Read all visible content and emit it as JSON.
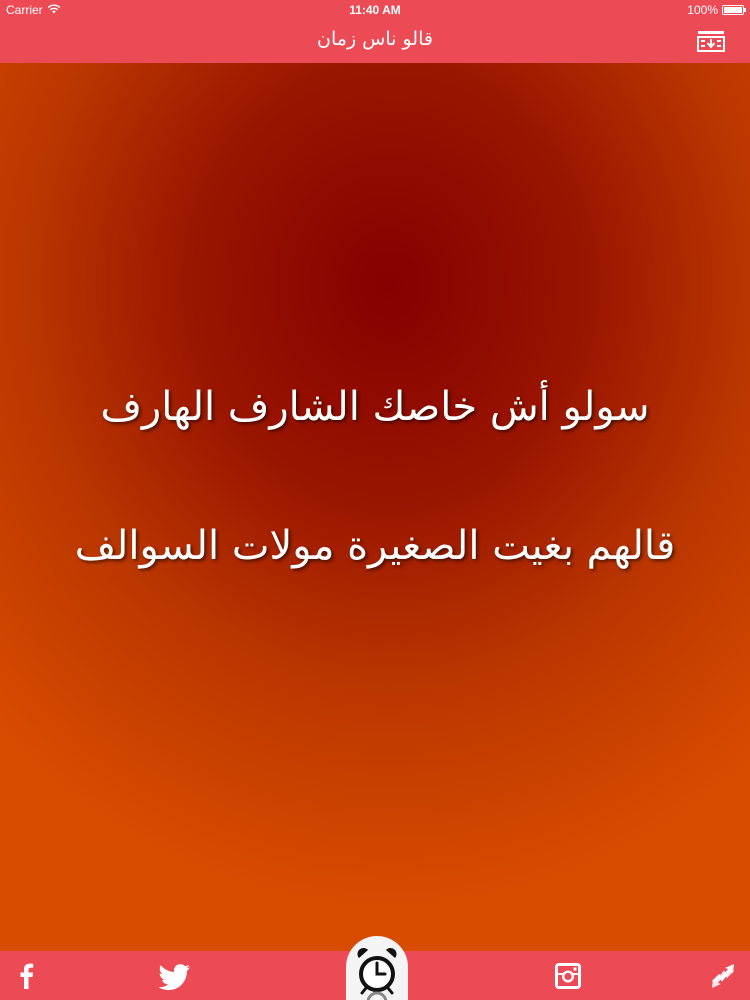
{
  "status_bar": {
    "carrier": "Carrier",
    "time": "11:40 AM",
    "battery": "100%",
    "battery_level": 1.0
  },
  "nav_bar": {
    "title": "قالو ناس زمان",
    "right_button_icon": "download-list-icon"
  },
  "quote": {
    "line1": "سولو أش خاصك الشارف الهارف",
    "line2": "قالهم بغيت الصغيرة مولات السوالف"
  },
  "tab_bar": {
    "items": [
      {
        "icon": "facebook-icon"
      },
      {
        "icon": "twitter-icon"
      },
      {
        "icon": "alarm-clock-icon"
      },
      {
        "icon": "instagram-icon"
      },
      {
        "icon": "shuffle-icon"
      }
    ]
  },
  "colors": {
    "bar": "#ec4b56",
    "gradient_center": "#850000",
    "gradient_edge": "#d84c00",
    "text": "#ffffff"
  }
}
